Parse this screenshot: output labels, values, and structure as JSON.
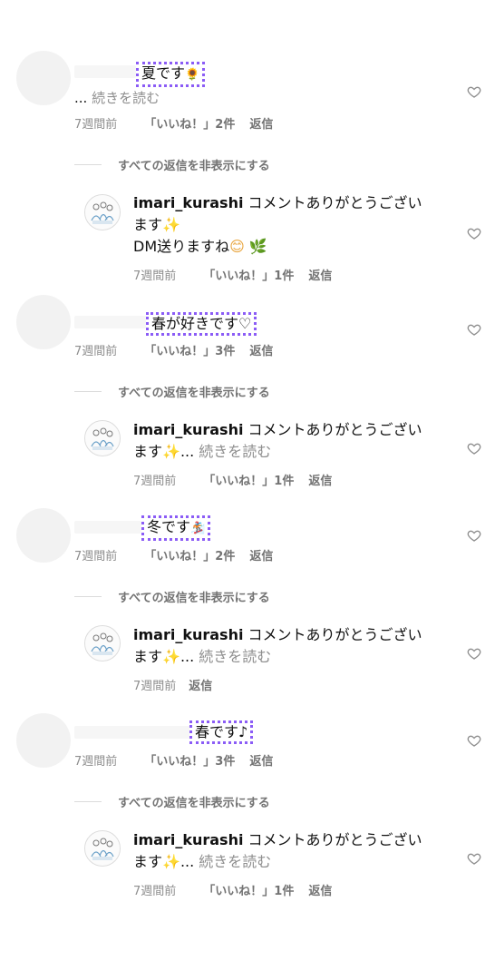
{
  "ui": {
    "more_label": "続きを読む",
    "ellipsis": "...",
    "time": "7週間前",
    "reply": "返信",
    "hide_replies": "すべての返信を非表示にする",
    "colors": {
      "highlight_border": "#8b5cf6",
      "muted_text": "#8e8e8e",
      "text": "#111111"
    }
  },
  "comments": [
    {
      "text": "夏です",
      "emoji": "🌻",
      "likes": "「いいね！」2件",
      "reply": {
        "username": "imari_kurashi",
        "line1": "コメントありがとうござい",
        "line2": "ます",
        "emoji1": "✨",
        "line3": "DM送りますね",
        "emoji2": "😊",
        "emoji3": "🌿",
        "likes": "「いいね！」1件"
      }
    },
    {
      "text": "春が好きです♡",
      "likes": "「いいね！」3件",
      "reply": {
        "username": "imari_kurashi",
        "line1": "コメントありがとうござい",
        "line2": "ます",
        "emoji1": "✨",
        "likes": "「いいね！」1件"
      }
    },
    {
      "text": "冬です",
      "emoji": "🏂",
      "likes": "「いいね！」2件",
      "reply": {
        "username": "imari_kurashi",
        "line1": "コメントありがとうござい",
        "line2": "ます",
        "emoji1": "✨"
      }
    },
    {
      "text": "春です♪",
      "likes": "「いいね！」3件",
      "reply": {
        "username": "imari_kurashi",
        "line1": "コメントありがとうござい",
        "line2": "ます",
        "emoji1": "✨",
        "likes": "「いいね！」1件"
      }
    }
  ]
}
